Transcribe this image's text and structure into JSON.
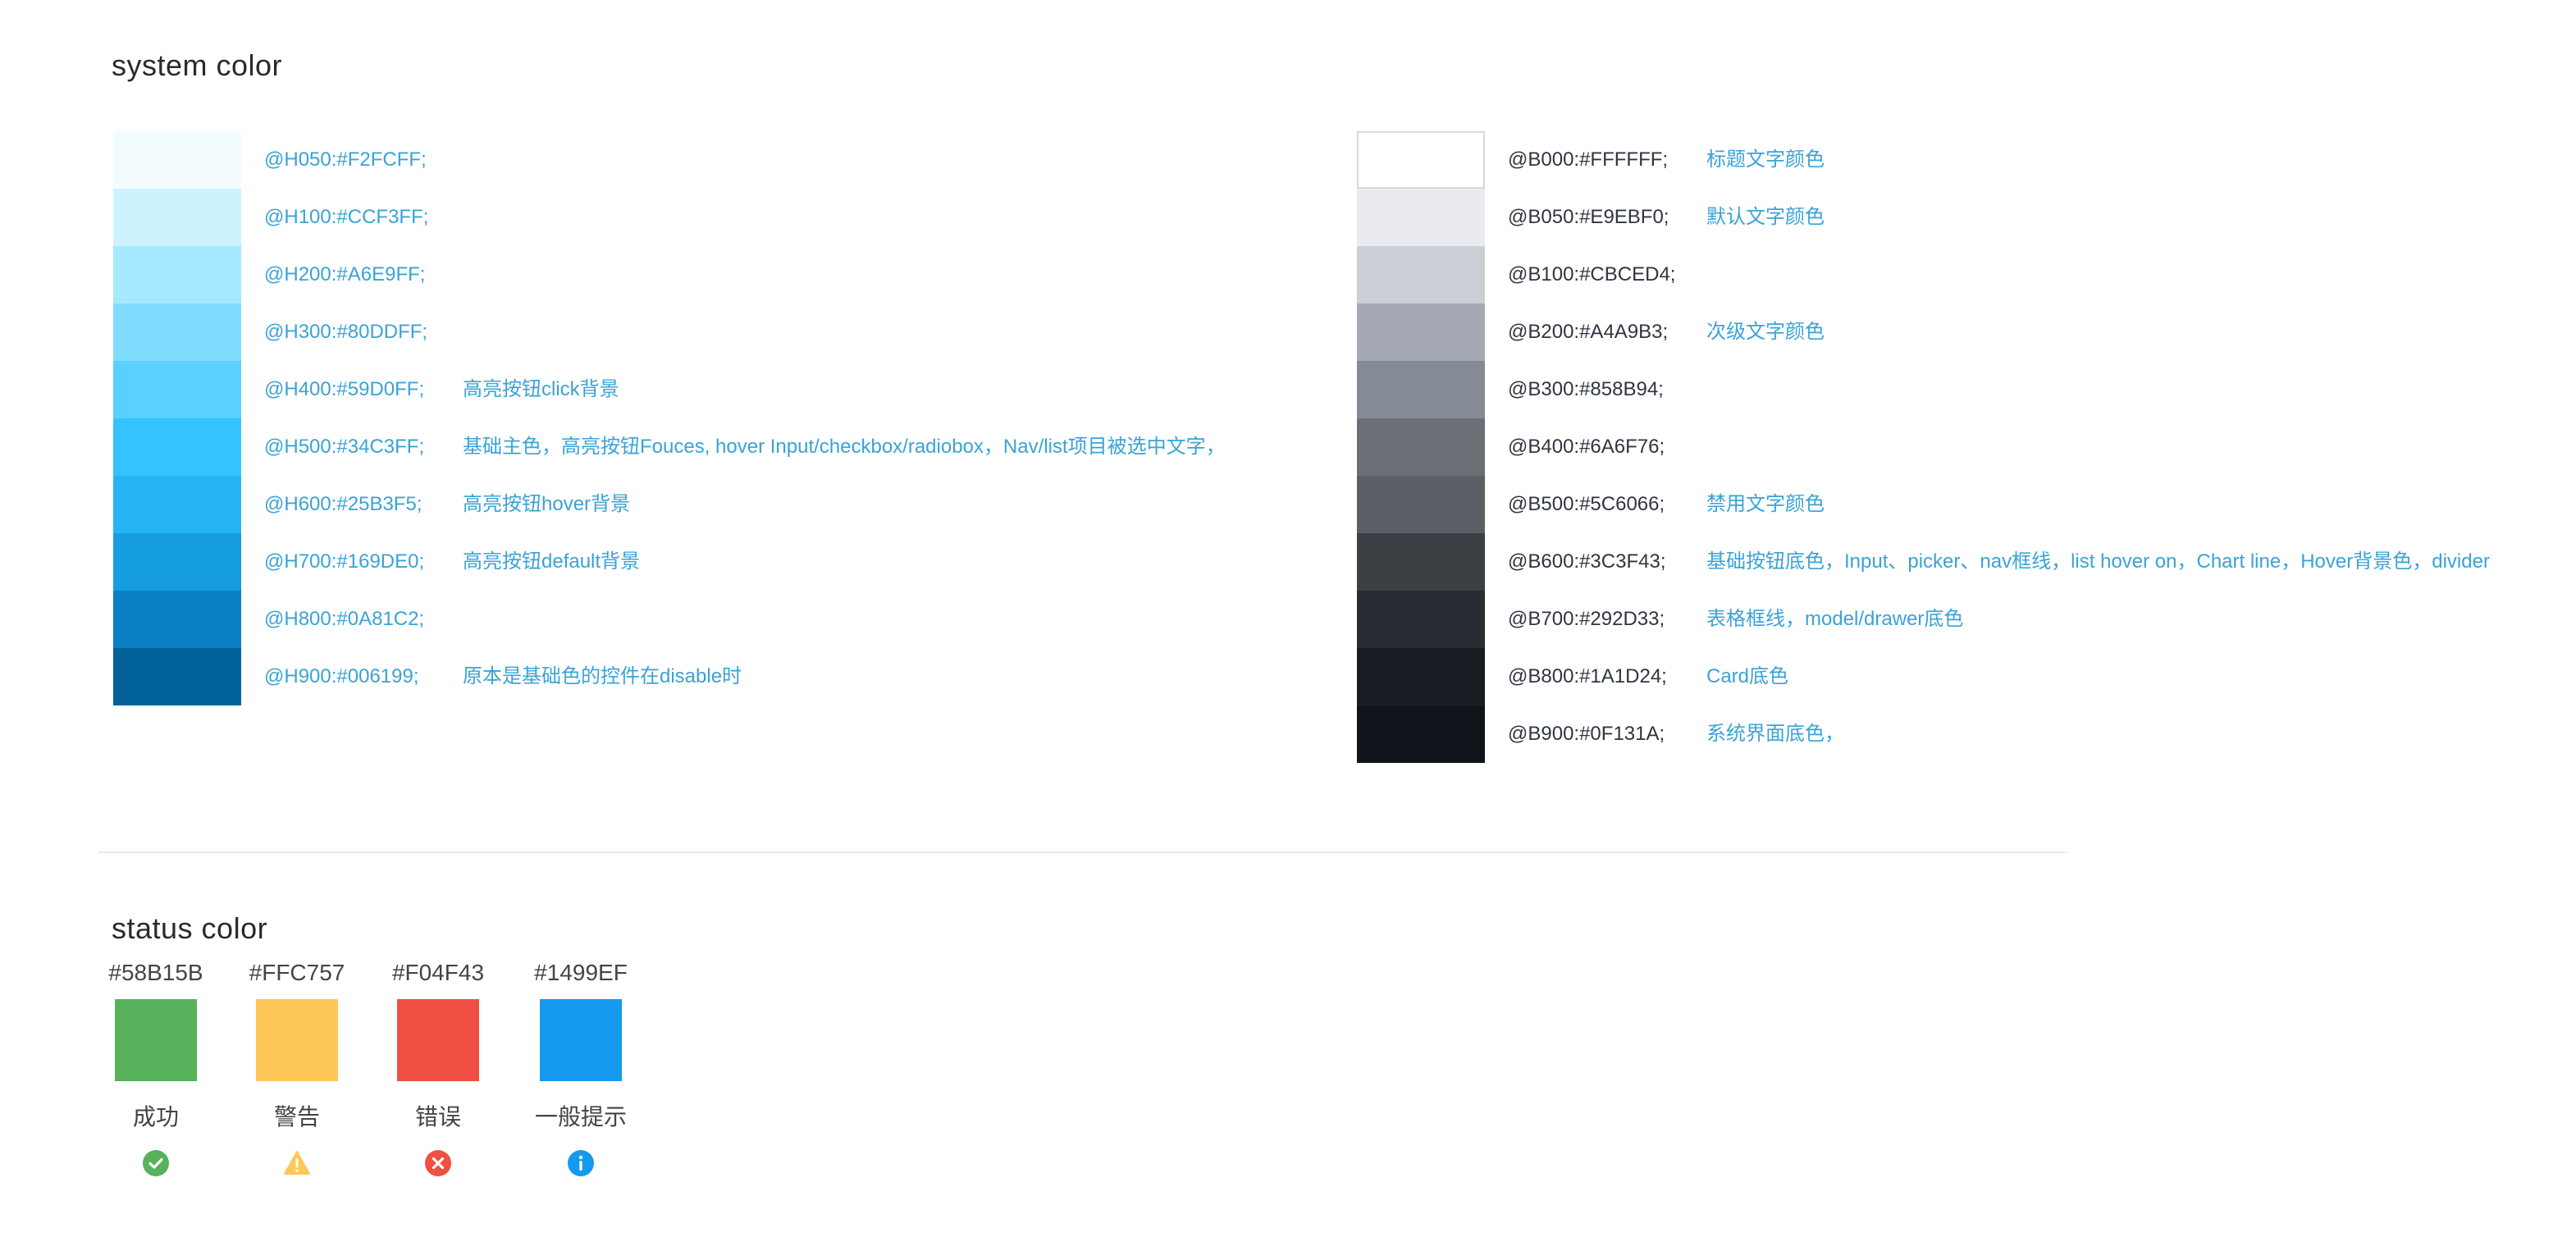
{
  "system_color": {
    "title": "system color",
    "left_palette": [
      {
        "code": "@H050:#F2FCFF;",
        "color": "#F2FCFF",
        "desc": ""
      },
      {
        "code": "@H100:#CCF3FF;",
        "color": "#CCF3FF",
        "desc": ""
      },
      {
        "code": "@H200:#A6E9FF;",
        "color": "#A6E9FF",
        "desc": ""
      },
      {
        "code": "@H300:#80DDFF;",
        "color": "#80DDFF",
        "desc": ""
      },
      {
        "code": "@H400:#59D0FF;",
        "color": "#59D0FF",
        "desc": "高亮按钮click背景"
      },
      {
        "code": "@H500:#34C3FF;",
        "color": "#34C3FF",
        "desc": "基础主色，高亮按钮Fouces, hover Input/checkbox/radiobox，Nav/list项目被选中文字，"
      },
      {
        "code": "@H600:#25B3F5;",
        "color": "#25B3F5",
        "desc": "高亮按钮hover背景"
      },
      {
        "code": "@H700:#169DE0;",
        "color": "#169DE0",
        "desc": "高亮按钮default背景"
      },
      {
        "code": "@H800:#0A81C2;",
        "color": "#0A81C2",
        "desc": ""
      },
      {
        "code": "@H900:#006199;",
        "color": "#006199",
        "desc": "原本是基础色的控件在disable时"
      }
    ],
    "right_palette": [
      {
        "code": "@B000:#FFFFFF;",
        "color": "#FFFFFF",
        "desc": "标题文字颜色"
      },
      {
        "code": "@B050:#E9EBF0;",
        "color": "#E9EBF0",
        "desc": "默认文字颜色"
      },
      {
        "code": "@B100:#CBCED4;",
        "color": "#CBCED4",
        "desc": ""
      },
      {
        "code": "@B200:#A4A9B3;",
        "color": "#A4A9B3",
        "desc": "次级文字颜色"
      },
      {
        "code": "@B300:#858B94;",
        "color": "#858B94",
        "desc": ""
      },
      {
        "code": "@B400:#6A6F76;",
        "color": "#6A6F76",
        "desc": ""
      },
      {
        "code": "@B500:#5C6066;",
        "color": "#5C6066",
        "desc": "禁用文字颜色"
      },
      {
        "code": "@B600:#3C3F43;",
        "color": "#3C3F43",
        "desc": "基础按钮底色，Input、picker、nav框线，list hover on，Chart line，Hover背景色，divider"
      },
      {
        "code": "@B700:#292D33;",
        "color": "#292D33",
        "desc": "表格框线，model/drawer底色"
      },
      {
        "code": "@B800:#1A1D24;",
        "color": "#1A1D24",
        "desc": "Card底色"
      },
      {
        "code": "@B900:#0F131A;",
        "color": "#0F131A",
        "desc": "系统界面底色，"
      }
    ]
  },
  "status_color": {
    "title": "status color",
    "items": [
      {
        "hex": "#58B15B",
        "color": "#58B15B",
        "label": "成功",
        "icon": "check-circle-icon"
      },
      {
        "hex": "#FFC757",
        "color": "#FFC757",
        "label": "警告",
        "icon": "warning-triangle-icon"
      },
      {
        "hex": "#F04F43",
        "color": "#F04F43",
        "label": "错误",
        "icon": "close-circle-icon"
      },
      {
        "hex": "#1499EF",
        "color": "#1499EF",
        "label": "一般提示",
        "icon": "info-circle-icon"
      }
    ]
  }
}
